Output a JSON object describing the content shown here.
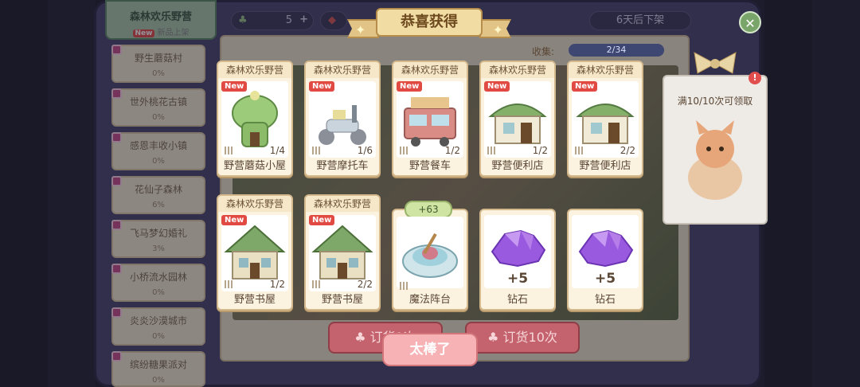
{
  "sidebar": {
    "top": {
      "title": "森林欢乐野营",
      "new_tag": "New",
      "sub": "新品上架"
    },
    "items": [
      {
        "name": "野生蘑菇村",
        "progress": "0%"
      },
      {
        "name": "世外桃花古镇",
        "progress": "0%"
      },
      {
        "name": "感恩丰收小镇",
        "progress": "0%"
      },
      {
        "name": "花仙子森林",
        "progress": "6%"
      },
      {
        "name": "飞马梦幻婚礼",
        "progress": "3%"
      },
      {
        "name": "小桥流水园林",
        "progress": "0%"
      },
      {
        "name": "炎炎沙漠城市",
        "progress": "0%"
      },
      {
        "name": "缤纷糖果派对",
        "progress": "0%"
      }
    ]
  },
  "header": {
    "currency_value": "5",
    "plus_icon": "plus-icon",
    "shelf_time": "6天后下架"
  },
  "collect": {
    "label": "收集:",
    "value": "2/34"
  },
  "banner": {
    "title": "恭喜获得"
  },
  "cards": [
    {
      "header": "森林欢乐野营",
      "name": "野营蘑菇小屋",
      "count": "1/4",
      "new": "New",
      "art": "mushroom"
    },
    {
      "header": "森林欢乐野营",
      "name": "野营摩托车",
      "count": "1/6",
      "new": "New",
      "art": "scooter"
    },
    {
      "header": "森林欢乐野营",
      "name": "野营餐车",
      "count": "1/2",
      "new": "New",
      "art": "truck"
    },
    {
      "header": "森林欢乐野营",
      "name": "野营便利店",
      "count": "1/2",
      "new": "New",
      "art": "shop"
    },
    {
      "header": "森林欢乐野营",
      "name": "野营便利店",
      "count": "2/2",
      "new": "New",
      "art": "shop"
    },
    {
      "header": "森林欢乐野营",
      "name": "野营书屋",
      "count": "1/2",
      "new": "New",
      "art": "house"
    },
    {
      "header": "森林欢乐野营",
      "name": "野营书屋",
      "count": "2/2",
      "new": "New",
      "art": "house"
    },
    {
      "header": "",
      "name": "魔法阵台",
      "badge": "+63",
      "art": "fountain"
    },
    {
      "header": "",
      "name": "钻石",
      "plus": "+5",
      "art": "diamond"
    },
    {
      "header": "",
      "name": "钻石",
      "plus": "+5",
      "art": "diamond"
    }
  ],
  "buttons": {
    "ok": "太棒了",
    "order1": "订货1次",
    "order10": "订货10次"
  },
  "reward": {
    "text": "满10/10次可领取"
  },
  "colors": {
    "accent": "#f6b2b5",
    "panel": "#4a4770",
    "card": "#fbf3df",
    "new_tag": "#e14a43"
  }
}
